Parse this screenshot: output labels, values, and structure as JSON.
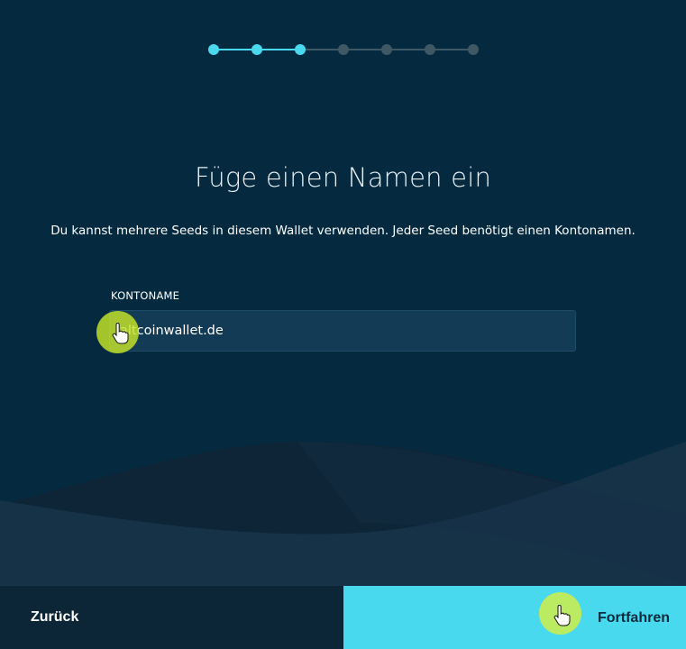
{
  "stepper": {
    "total_steps": 7,
    "active_steps": 3
  },
  "heading": {
    "title": "Füge einen Namen ein"
  },
  "description": "Du kannst mehrere Seeds in diesem Wallet verwenden. Jeder Seed benötigt einen Kontonamen.",
  "account_field": {
    "label": "KONTONAME",
    "value": "altcoinwallet.de"
  },
  "footer": {
    "back_label": "Zurück",
    "continue_label": "Fortfahren"
  },
  "colors": {
    "background": "#052a3f",
    "accent": "#49d9ef",
    "inactive_step": "#3e5866",
    "cursor_highlight": "#c8e628"
  },
  "icons": {
    "pointer": "hand-pointer-icon"
  }
}
